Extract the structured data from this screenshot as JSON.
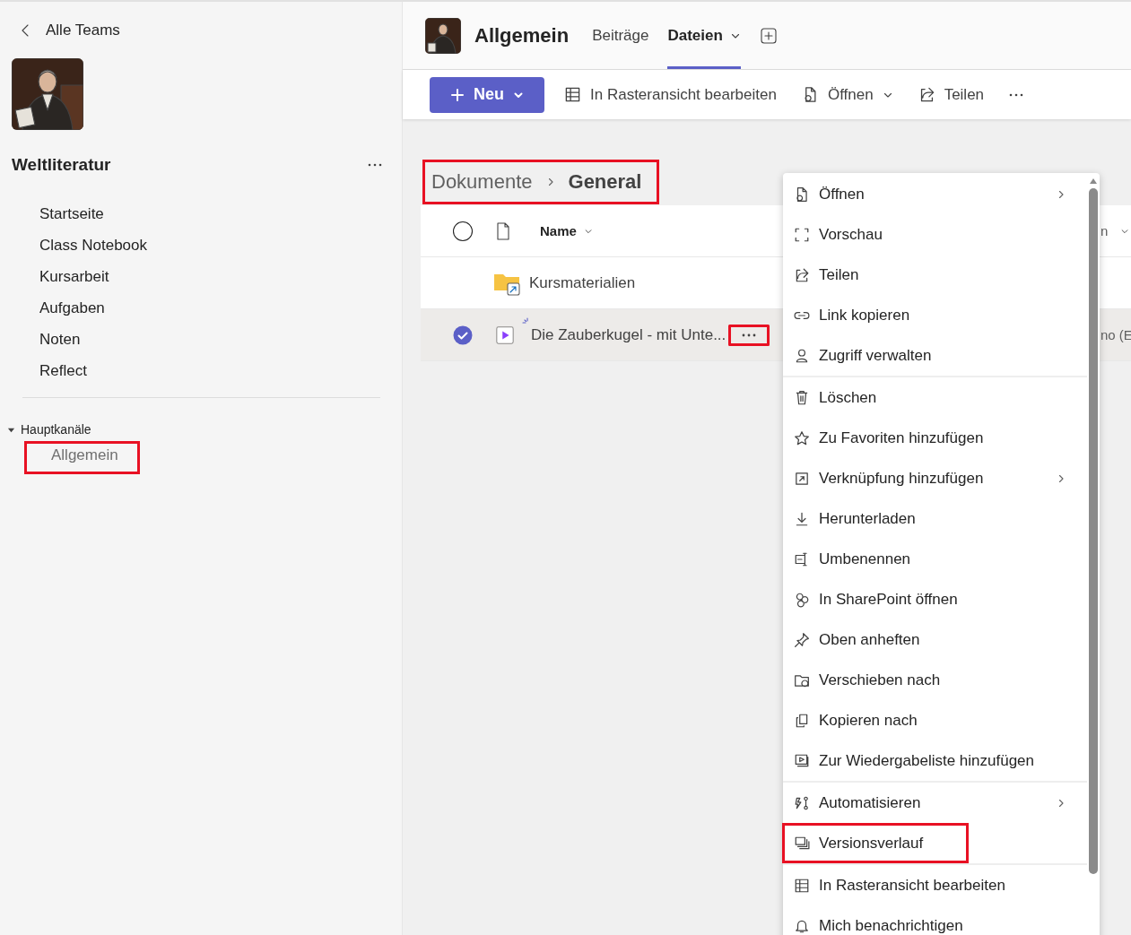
{
  "sidebar": {
    "back_link": "Alle Teams",
    "team_name": "Weltliteratur",
    "nav_items": [
      "Startseite",
      "Class Notebook",
      "Kursarbeit",
      "Aufgaben",
      "Noten",
      "Reflect"
    ],
    "channels_group": {
      "label": "Hauptkanäle",
      "expanded": true
    },
    "channels": [
      {
        "label": "Allgemein",
        "highlighted": true
      }
    ]
  },
  "header": {
    "title": "Allgemein",
    "tabs": [
      {
        "label": "Beiträge",
        "selected": false,
        "dropdown": false
      },
      {
        "label": "Dateien",
        "selected": true,
        "dropdown": true
      }
    ]
  },
  "toolbar": {
    "new_button": "Neu",
    "actions": [
      {
        "label": "In Rasteransicht bearbeiten",
        "dropdown": false
      },
      {
        "label": "Öffnen",
        "dropdown": true
      },
      {
        "label": "Teilen",
        "dropdown": false
      }
    ]
  },
  "breadcrumb": {
    "items": [
      "Dokumente",
      "General"
    ],
    "highlighted": true
  },
  "table": {
    "select_all_checked": false,
    "columns": [
      {
        "label": "Name"
      },
      {
        "label": "n"
      }
    ],
    "rows": [
      {
        "name": "Kursmaterialien",
        "kind": "folder",
        "selected": false,
        "new": false,
        "more_highlighted": false
      },
      {
        "name": "Die Zauberkugel - mit Unte...",
        "kind": "video",
        "selected": true,
        "new": true,
        "more_highlighted": true,
        "column_3": "no (E"
      }
    ]
  },
  "context_menu": {
    "sections": [
      [
        {
          "label": "Öffnen",
          "submenu": true,
          "highlighted": false
        },
        {
          "label": "Vorschau",
          "submenu": false,
          "highlighted": false
        },
        {
          "label": "Teilen",
          "submenu": false,
          "highlighted": false
        },
        {
          "label": "Link kopieren",
          "submenu": false,
          "highlighted": false
        },
        {
          "label": "Zugriff verwalten",
          "submenu": false,
          "highlighted": false
        }
      ],
      [
        {
          "label": "Löschen",
          "submenu": false,
          "highlighted": false
        },
        {
          "label": "Zu Favoriten hinzufügen",
          "submenu": false,
          "highlighted": false
        },
        {
          "label": "Verknüpfung hinzufügen",
          "submenu": true,
          "highlighted": false
        },
        {
          "label": "Herunterladen",
          "submenu": false,
          "highlighted": false
        },
        {
          "label": "Umbenennen",
          "submenu": false,
          "highlighted": false
        },
        {
          "label": "In SharePoint öffnen",
          "submenu": false,
          "highlighted": false
        },
        {
          "label": "Oben anheften",
          "submenu": false,
          "highlighted": false
        },
        {
          "label": "Verschieben nach",
          "submenu": false,
          "highlighted": false
        },
        {
          "label": "Kopieren nach",
          "submenu": false,
          "highlighted": false
        },
        {
          "label": "Zur Wiedergabeliste hinzufügen",
          "submenu": false,
          "highlighted": false
        }
      ],
      [
        {
          "label": "Automatisieren",
          "submenu": true,
          "highlighted": false
        },
        {
          "label": "Versionsverlauf",
          "submenu": false,
          "highlighted": true
        }
      ],
      [
        {
          "label": "In Rasteransicht bearbeiten",
          "submenu": false,
          "highlighted": false
        },
        {
          "label": "Mich benachrichtigen",
          "submenu": false,
          "highlighted": false
        }
      ]
    ]
  }
}
